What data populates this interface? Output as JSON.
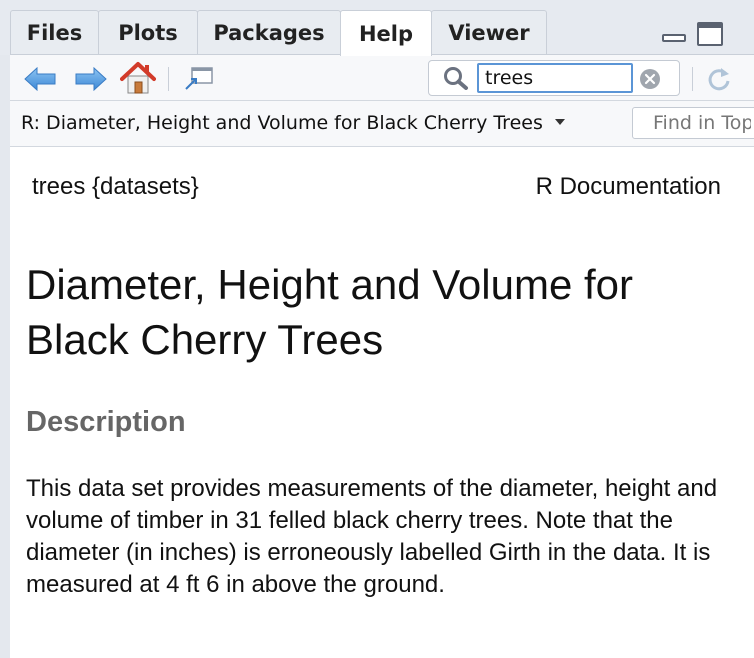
{
  "tabs": [
    {
      "label": "Files",
      "active": false
    },
    {
      "label": "Plots",
      "active": false
    },
    {
      "label": "Packages",
      "active": false
    },
    {
      "label": "Help",
      "active": true
    },
    {
      "label": "Viewer",
      "active": false
    }
  ],
  "toolbar": {
    "back_icon": "arrow-left-icon",
    "forward_icon": "arrow-right-icon",
    "home_icon": "home-icon",
    "popout_icon": "show-in-new-window-icon",
    "refresh_icon": "refresh-icon"
  },
  "search": {
    "value": "trees"
  },
  "topic": {
    "selected": "R: Diameter, Height and Volume for Black Cherry Trees"
  },
  "find": {
    "placeholder": "Find in Topic"
  },
  "doc": {
    "package_label": "trees {datasets}",
    "doc_label": "R Documentation",
    "title": "Diameter, Height and Volume for Black Cherry Trees",
    "section_heading": "Description",
    "description": "This data set provides measurements of the diameter, height and volume of timber in 31 felled black cherry trees. Note that the diameter (in inches) is erroneously labelled Girth in the data. It is measured at 4 ft 6 in above the ground."
  },
  "colors": {
    "arrow_blue": "#5aa0e0",
    "home_red": "#d23b2a",
    "section_gray": "#666666",
    "focus_blue": "#5b95d6"
  }
}
